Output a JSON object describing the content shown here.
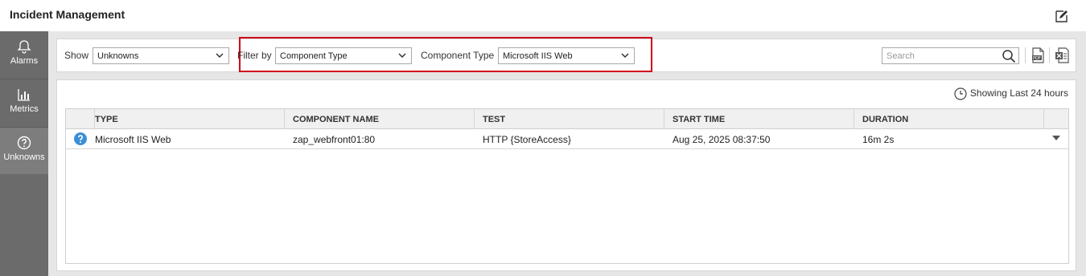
{
  "header": {
    "title": "Incident Management",
    "edit_icon": "edit-icon"
  },
  "sidebar": {
    "items": [
      {
        "label": "Alarms",
        "icon": "bell-icon"
      },
      {
        "label": "Metrics",
        "icon": "bar-chart-icon"
      },
      {
        "label": "Unknowns",
        "icon": "question-circle-icon",
        "active": true
      }
    ]
  },
  "toolbar": {
    "show_label": "Show",
    "show_value": "Unknowns",
    "filter_by_label": "Filter by",
    "filter_by_value": "Component Type",
    "component_type_label": "Component Type",
    "component_type_value": "Microsoft IIS Web",
    "search_placeholder": "Search",
    "highlight_color": "#d0021b"
  },
  "panel": {
    "showing_text": "Showing Last 24 hours",
    "columns": [
      "TYPE",
      "COMPONENT NAME",
      "TEST",
      "START TIME",
      "DURATION"
    ],
    "rows": [
      {
        "type": "Microsoft IIS Web",
        "component_name": "zap_webfront01:80",
        "test": "HTTP {StoreAccess}",
        "start_time": "Aug 25, 2025 08:37:50",
        "duration": "16m 2s",
        "status_icon": "question-circle-icon"
      }
    ]
  }
}
